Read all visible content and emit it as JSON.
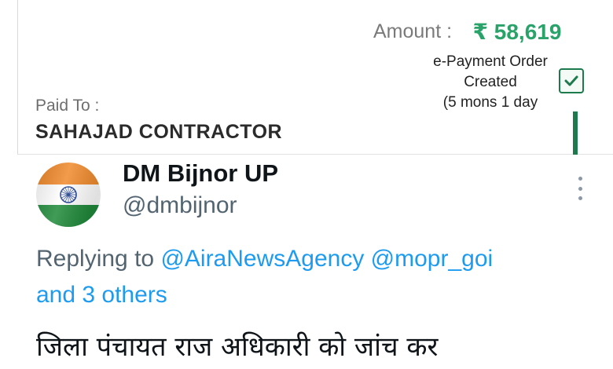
{
  "payment": {
    "amount_label": "Amount :",
    "amount_value": "₹ 58,619",
    "status_line1": "e-Payment Order",
    "status_line2": "Created",
    "status_line3": "(5 mons 1 day",
    "paid_to_label": "Paid To :",
    "payee_name": "SAHAJAD CONTRACTOR",
    "accent_color": "#29a36a",
    "status_color": "#1d7a4c"
  },
  "tweet": {
    "display_name": "DM Bijnor UP",
    "handle": "@dmbijnor",
    "replying_prefix": "Replying to",
    "mention_1": "@AiraNewsAgency",
    "mention_2": "@mopr_goi",
    "others": "and 3 others",
    "text": "जिला पंचायत राज अधिकारी को जांच कर",
    "avatar_icon": "india-flag-avatar",
    "more_icon": "more-options-icon",
    "link_color": "#1d9bf0"
  }
}
